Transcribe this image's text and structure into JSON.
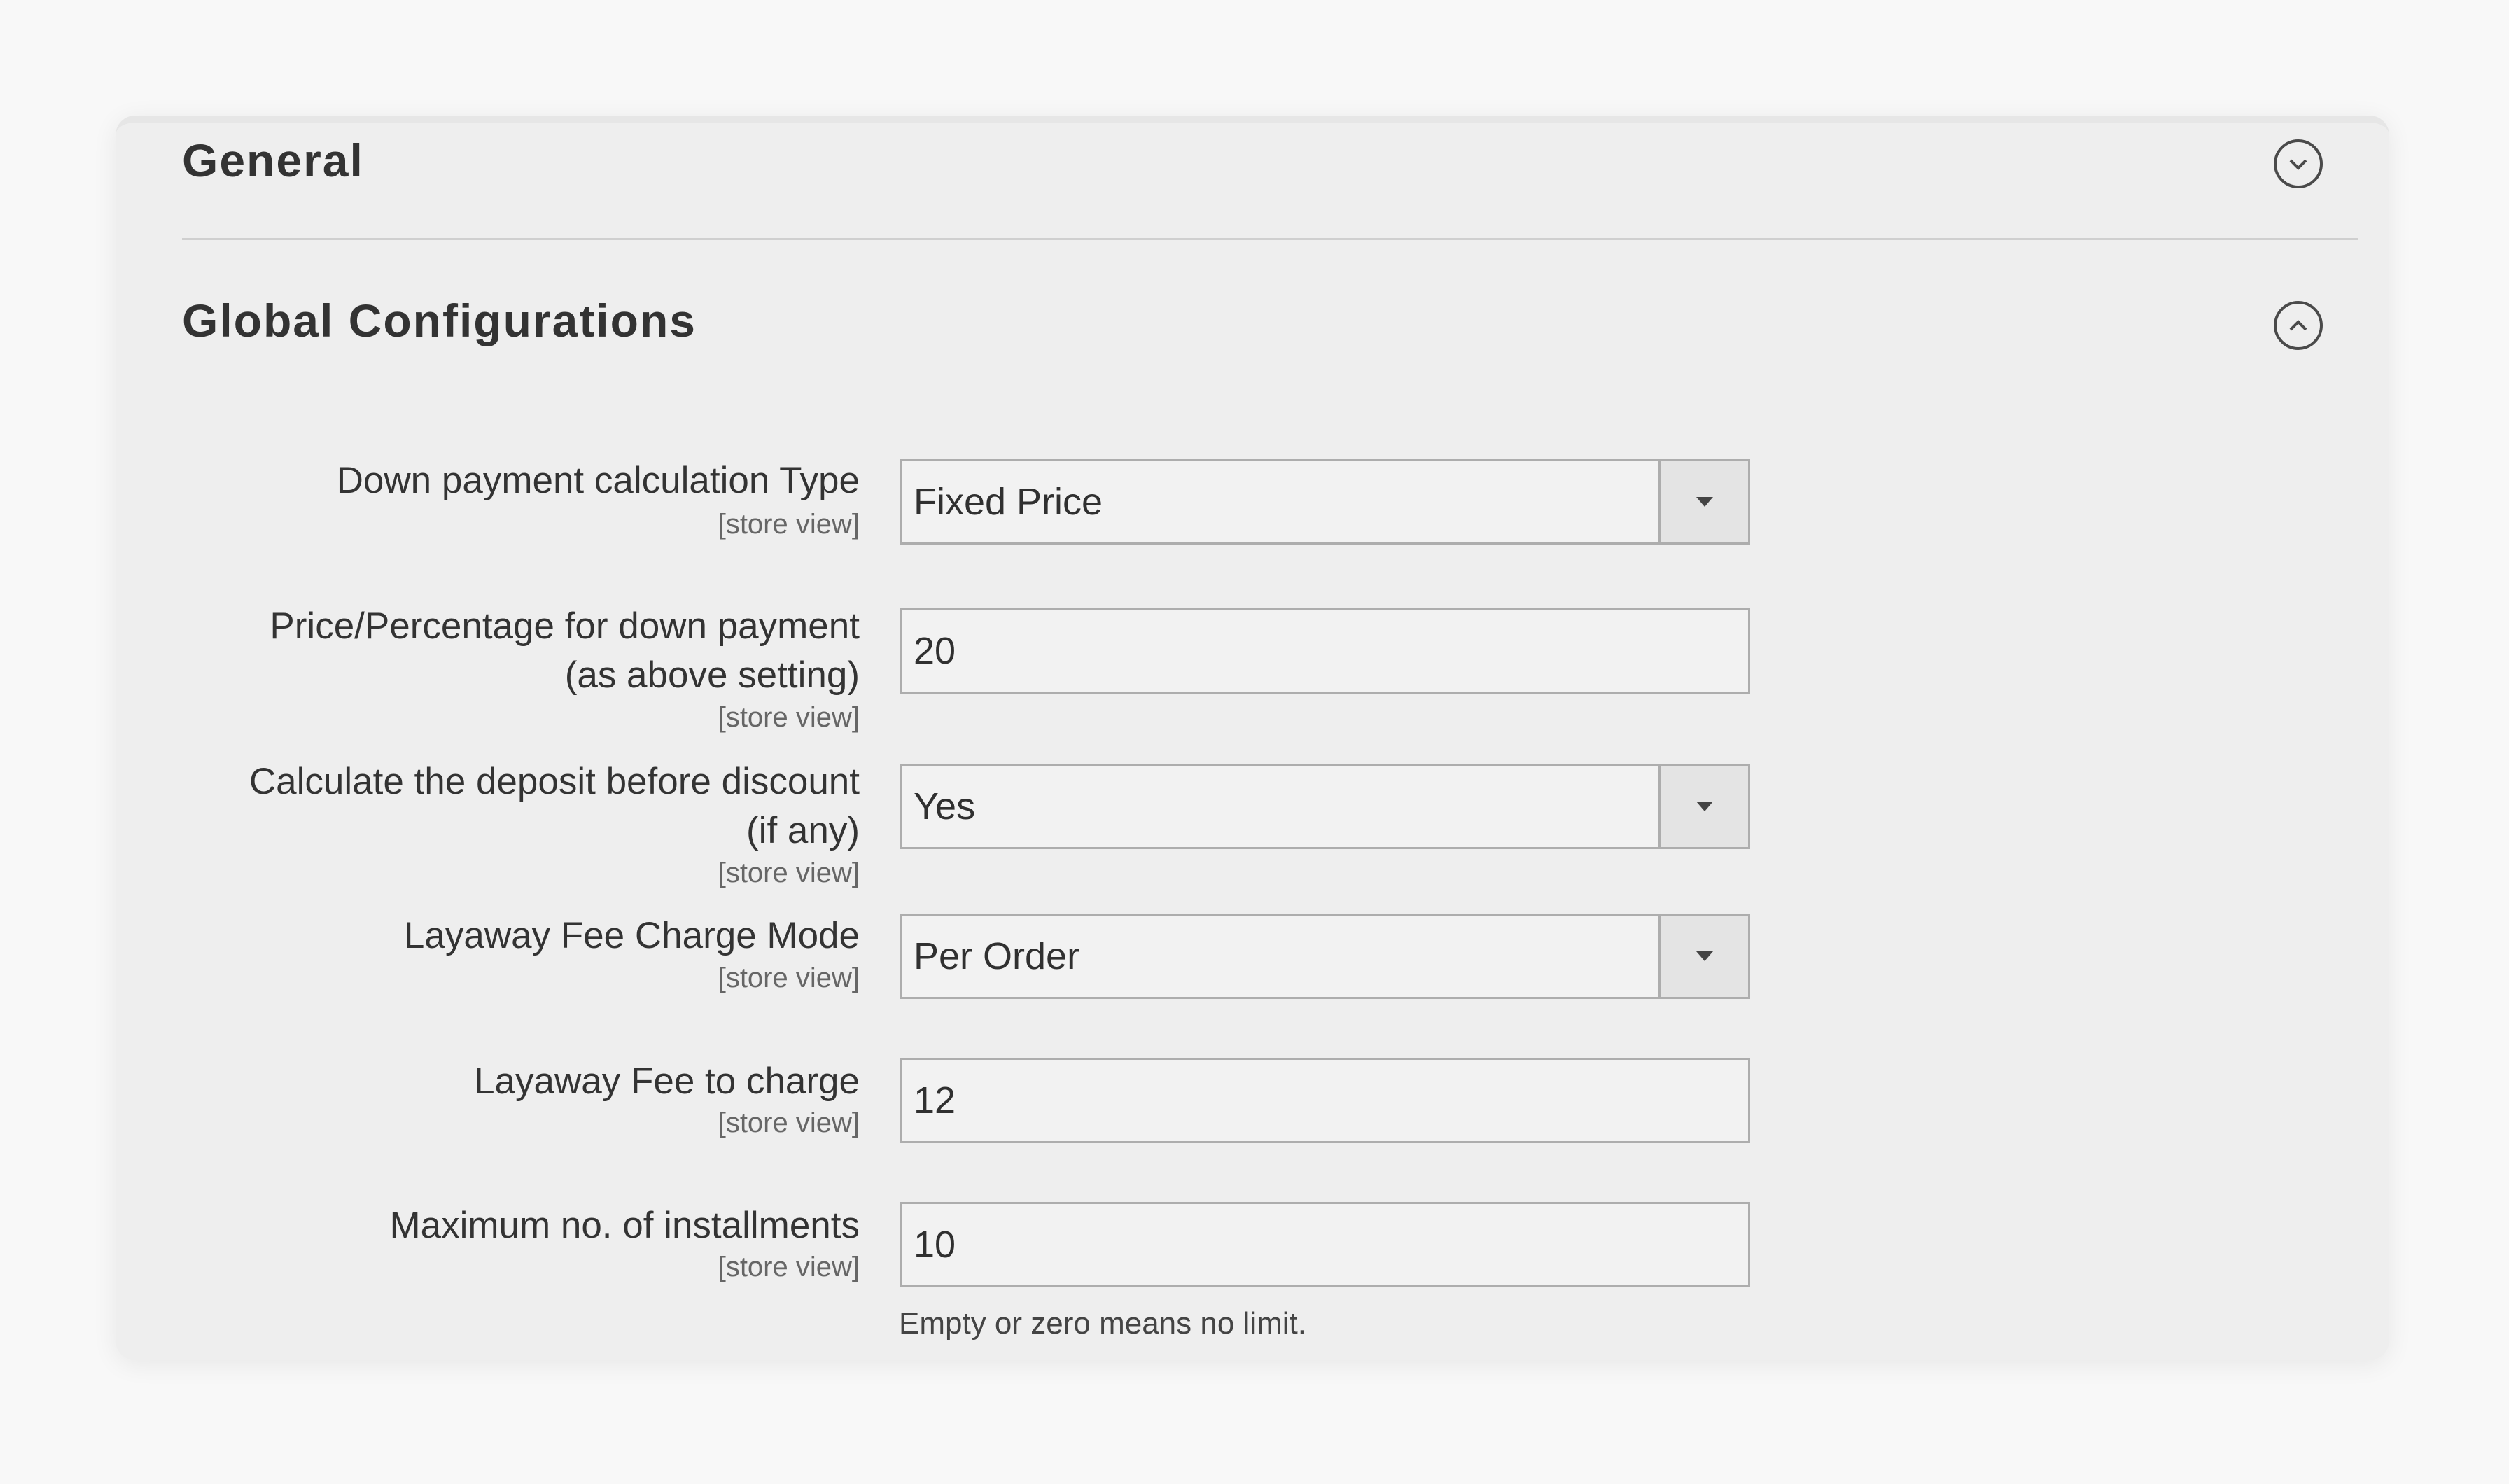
{
  "sections": {
    "general": {
      "title": "General",
      "toggle_icon": "chevron-down-circle-icon"
    },
    "global": {
      "title": "Global Configurations",
      "toggle_icon": "chevron-up-circle-icon"
    }
  },
  "fields": [
    {
      "label": "Down payment calculation Type",
      "scope": "[store view]",
      "type": "select",
      "value": "Fixed Price"
    },
    {
      "label_line1": "Price/Percentage for down payment",
      "label_line2": "(as above setting)",
      "scope": "[store view]",
      "type": "text",
      "value": "20"
    },
    {
      "label_line1": "Calculate the deposit before discount",
      "label_line2": "(if any)",
      "scope": "[store view]",
      "type": "select",
      "value": "Yes"
    },
    {
      "label": "Layaway Fee Charge Mode",
      "scope": "[store view]",
      "type": "select",
      "value": "Per Order"
    },
    {
      "label": "Layaway Fee to charge",
      "scope": "[store view]",
      "type": "text",
      "value": "12"
    },
    {
      "label": "Maximum no. of installments",
      "scope": "[store view]",
      "type": "text",
      "value": "10",
      "note": "Empty or zero means no limit."
    }
  ]
}
